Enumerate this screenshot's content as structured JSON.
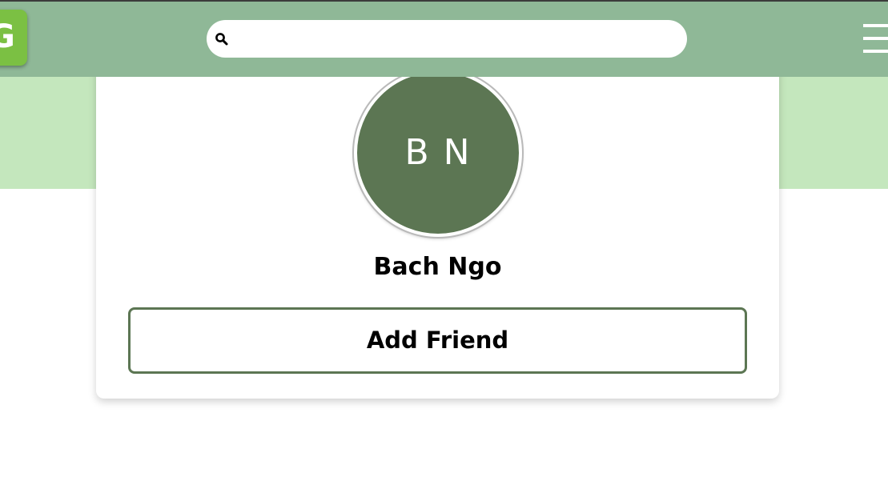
{
  "header": {
    "logo_letter": "G",
    "search": {
      "placeholder": "",
      "value": ""
    },
    "menu_icon": "hamburger-menu-icon",
    "colors": {
      "navbar": "#8fb897",
      "logo": "#7bc043"
    }
  },
  "banner": {
    "color": "#c4e7bd"
  },
  "profile": {
    "initials": "B N",
    "name": "Bach Ngo",
    "add_friend_label": "Add Friend",
    "avatar_color": "#5c7653",
    "button_border_color": "#5c7653"
  }
}
